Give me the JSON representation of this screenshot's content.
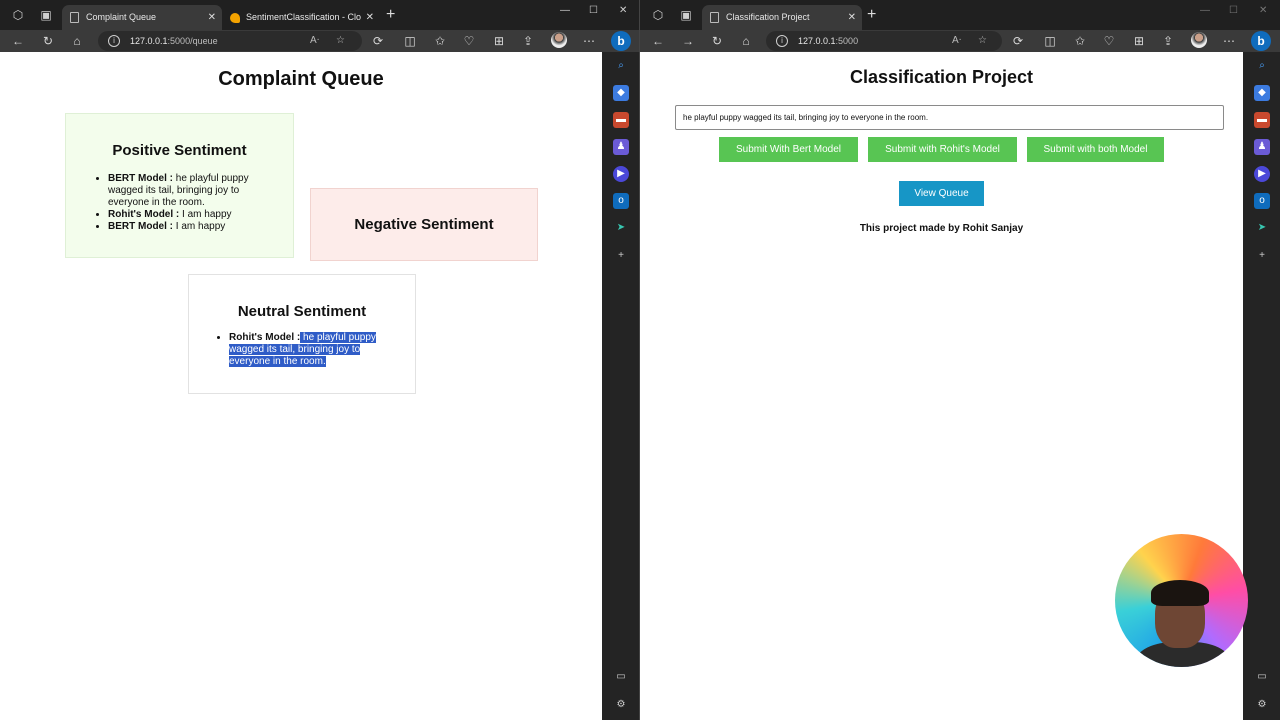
{
  "left_window": {
    "tabs": [
      {
        "title": "Complaint Queue"
      },
      {
        "title": "SentimentClassification - Cloud F"
      }
    ],
    "url_host": "127.0.0.1",
    "url_rest": ":5000/queue",
    "page": {
      "title": "Complaint Queue",
      "positive": {
        "heading": "Positive Sentiment",
        "items": [
          {
            "model": "BERT Model :",
            "text": " he playful puppy wagged its tail, bringing joy to everyone in the room."
          },
          {
            "model": "Rohit's Model :",
            "text": " I am happy"
          },
          {
            "model": "BERT Model :",
            "text": " I am happy"
          }
        ]
      },
      "negative": {
        "heading": "Negative Sentiment"
      },
      "neutral": {
        "heading": "Neutral Sentiment",
        "items": [
          {
            "model": "Rohit's Model :",
            "text": " he playful puppy wagged its tail, bringing joy to everyone in the room."
          }
        ]
      }
    }
  },
  "right_window": {
    "tabs": [
      {
        "title": "Classification Project"
      }
    ],
    "url_host": "127.0.0.1",
    "url_rest": ":5000",
    "page": {
      "title": "Classification Project",
      "input_value": "he playful puppy wagged its tail, bringing joy to everyone in the room.",
      "buttons": {
        "bert": "Submit With Bert Model",
        "rohit": "Submit with Rohit's Model",
        "both": "Submit with both Model",
        "queue": "View Queue"
      },
      "credit": "This project made by Rohit Sanjay"
    }
  },
  "colors": {
    "positive_bg": "#f3fdec",
    "negative_bg": "#fdecea",
    "neutral_bg": "#ffffff",
    "green_button": "#58c553",
    "blue_button": "#1796c6",
    "selection": "#2f5cc7"
  },
  "icons": [
    "workspaces-icon",
    "tab-actions-icon",
    "page-icon",
    "cloud-icon",
    "back-icon",
    "refresh-icon",
    "forward-icon",
    "home-icon",
    "info-icon",
    "read-aloud-icon",
    "favorite-icon",
    "extensions-icon",
    "split-screen-icon",
    "favorites-icon",
    "browser-essentials-icon",
    "collections-icon",
    "share-icon",
    "profile-avatar",
    "more-icon",
    "copilot-icon",
    "search-icon",
    "shopping-icon",
    "tools-icon",
    "games-icon",
    "media-icon",
    "outlook-icon",
    "drop-icon",
    "add-icon",
    "sidebar-toggle-icon",
    "settings-icon"
  ]
}
